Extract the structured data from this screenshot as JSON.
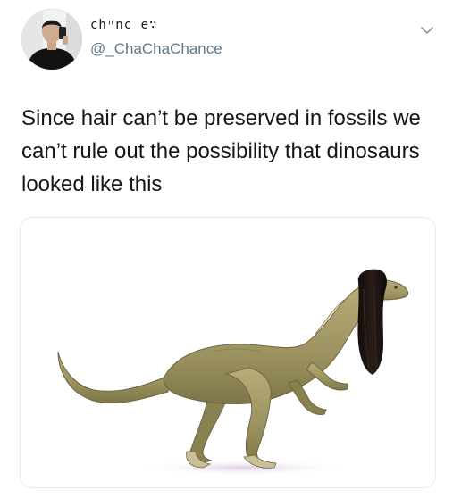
{
  "tweet": {
    "display_name": "chⁿnc e∵",
    "handle": "@_ChaChaChance",
    "text": "Since hair can’t be preserved in fossils we can’t rule out the possibility that dinosaurs looked like this"
  },
  "icons": {
    "avatar": "user-photo-avatar",
    "menu": "chevron-down-icon"
  },
  "media": {
    "subject": "dinosaur-with-long-black-hair-illustration"
  },
  "colors": {
    "text": "#14171a",
    "handle": "#657786",
    "border": "#e8ebed",
    "dino_body": "#a79e6a",
    "hair": "#1c1411"
  }
}
